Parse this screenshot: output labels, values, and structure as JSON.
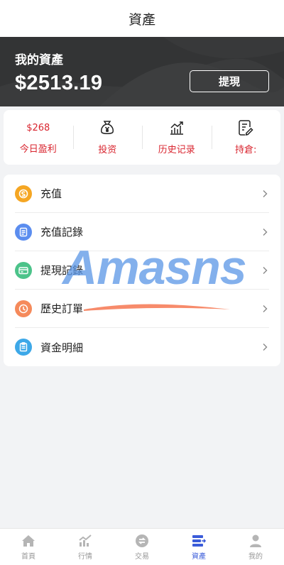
{
  "header": {
    "title": "資產"
  },
  "hero": {
    "label": "我的資產",
    "balance": "$2513.19",
    "withdraw_label": "提現"
  },
  "stats": [
    {
      "value": "$268",
      "label": "今日盈利",
      "icon": "none"
    },
    {
      "label": "投资",
      "icon": "money-bag-icon"
    },
    {
      "label": "历史记录",
      "icon": "bar-chart-icon"
    },
    {
      "label": "持倉:",
      "icon": "document-edit-icon"
    }
  ],
  "menu": [
    {
      "label": "充值",
      "icon": "coin-icon",
      "color": "#f5a623"
    },
    {
      "label": "充值記錄",
      "icon": "list-icon",
      "color": "#5b8def"
    },
    {
      "label": "提現記錄",
      "icon": "card-icon",
      "color": "#4cc38a"
    },
    {
      "label": "歷史訂單",
      "icon": "clock-icon",
      "color": "#f58a5b"
    },
    {
      "label": "資金明細",
      "icon": "clipboard-icon",
      "color": "#3da8e8"
    }
  ],
  "watermark": {
    "text": "Amasns"
  },
  "tabbar": [
    {
      "label": "首頁",
      "icon": "home-icon",
      "active": false
    },
    {
      "label": "行情",
      "icon": "trend-icon",
      "active": false
    },
    {
      "label": "交易",
      "icon": "exchange-icon",
      "active": false
    },
    {
      "label": "資產",
      "icon": "assets-icon",
      "active": true
    },
    {
      "label": "我的",
      "icon": "user-icon",
      "active": false
    }
  ],
  "colors": {
    "accent": "#3a5bd9",
    "hero_bg": "#333435",
    "stat_red": "#d9252f"
  }
}
